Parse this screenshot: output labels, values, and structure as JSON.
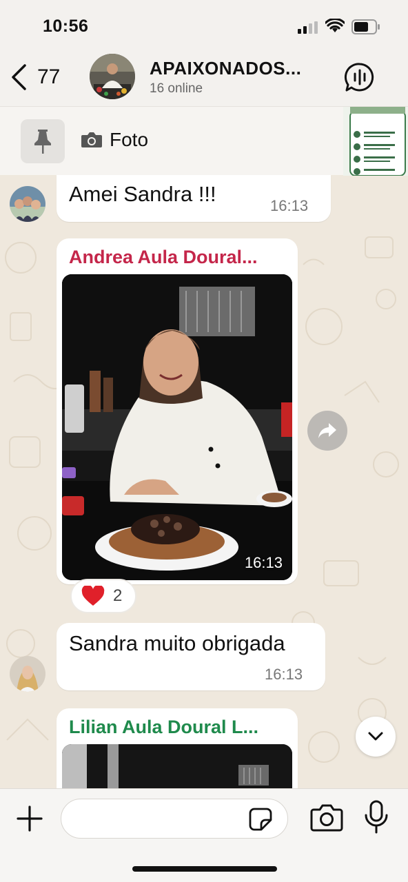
{
  "status_bar": {
    "time": "10:56"
  },
  "header": {
    "back_count": "77",
    "group_name": "APAIXONADOS...",
    "subtitle": "16 online"
  },
  "pinned": {
    "label": "Foto"
  },
  "messages": [
    {
      "text": "Amei Sandra !!!",
      "time": "16:13"
    },
    {
      "sender": "Andrea Aula Doural...",
      "sender_color": "#c4264a",
      "time": "16:13",
      "reaction_emoji": "❤️",
      "reaction_count": "2"
    },
    {
      "text": "Sandra muito obrigada",
      "time": "16:13"
    },
    {
      "sender": "Lilian Aula Doural L...",
      "sender_color": "#1f8a4c"
    }
  ],
  "icons": {
    "back": "chevron-left-icon",
    "voice": "voice-chat-icon",
    "pin": "pin-icon",
    "camera": "camera-icon",
    "forward": "forward-icon",
    "scroll_down": "chevron-down-icon",
    "plus": "plus-icon",
    "sticker": "sticker-icon",
    "mic": "microphone-icon"
  }
}
